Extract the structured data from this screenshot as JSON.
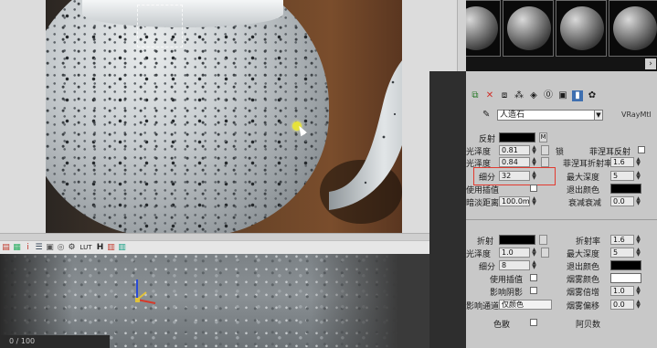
{
  "render_frame": {
    "toolbar_icons": [
      "rgb-icon",
      "alpha-icon",
      "info-icon",
      "clear-icon",
      "preview-icon",
      "copy-icon",
      "save-icon",
      "lut-icon",
      "h-icon",
      "stereo-icon",
      "channel-icon"
    ],
    "toolbar_label_h": "H",
    "toolbar_label_i": "i",
    "toolbar_label_lut": "LUT"
  },
  "material_editor": {
    "material_name": "人造石",
    "material_type": "VRayMtl",
    "reflection": {
      "label_reflect": "反射",
      "label_m": "M",
      "label_hilight_gloss": "光泽度",
      "hilight_gloss": "0.81",
      "label_refl_gloss": "光泽度",
      "refl_gloss": "0.84",
      "label_lock": "锁",
      "label_fresnel": "菲涅耳反射",
      "label_fresnel_ior": "菲涅耳折射率",
      "fresnel_ior": "1.6",
      "label_subdivs": "细分",
      "subdivs": "32",
      "label_max_depth": "最大深度",
      "max_depth": "5",
      "label_use_interp": "使用插值",
      "label_exit_color": "退出颜色",
      "label_dim_distance": "暗淡距离",
      "dim_distance": "100.0m",
      "label_dim_falloff": "衰减衰减",
      "dim_falloff": "0.0"
    },
    "refraction": {
      "label_refract": "折射",
      "label_ior": "折射率",
      "ior": "1.6",
      "label_gloss": "光泽度",
      "gloss": "1.0",
      "label_max_depth": "最大深度",
      "max_depth": "5",
      "label_subdivs": "细分",
      "subdivs": "8",
      "label_exit_color": "退出颜色",
      "label_use_interp": "使用插值",
      "label_fog_color": "烟雾颜色",
      "label_affect_shadows": "影响阴影",
      "label_fog_mult": "烟雾倍增",
      "fog_mult": "1.0",
      "label_affect_channels": "影响通道",
      "affect_channels_value": "仅颜色",
      "label_fog_bias": "烟雾偏移",
      "fog_bias": "0.0",
      "label_dispersion": "色散",
      "label_abbe": "阿贝数"
    }
  },
  "status": {
    "frame": "0 / 100"
  },
  "colors": {
    "highlight_border": "#e23a2f",
    "active_button": "#3e6fb0"
  }
}
